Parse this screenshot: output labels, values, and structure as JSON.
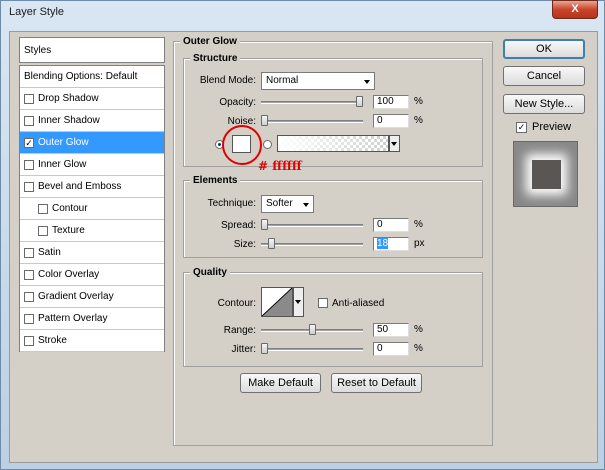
{
  "window": {
    "title": "Layer Style",
    "close_label": "X"
  },
  "sidebar": {
    "header": "Styles",
    "items": [
      {
        "label": "Blending Options: Default",
        "checkbox": false,
        "indent": 0,
        "selected": false
      },
      {
        "label": "Drop Shadow",
        "checkbox": true,
        "checked": false,
        "indent": 0,
        "selected": false
      },
      {
        "label": "Inner Shadow",
        "checkbox": true,
        "checked": false,
        "indent": 0,
        "selected": false
      },
      {
        "label": "Outer Glow",
        "checkbox": true,
        "checked": true,
        "indent": 0,
        "selected": true
      },
      {
        "label": "Inner Glow",
        "checkbox": true,
        "checked": false,
        "indent": 0,
        "selected": false
      },
      {
        "label": "Bevel and Emboss",
        "checkbox": true,
        "checked": false,
        "indent": 0,
        "selected": false
      },
      {
        "label": "Contour",
        "checkbox": true,
        "checked": false,
        "indent": 1,
        "selected": false
      },
      {
        "label": "Texture",
        "checkbox": true,
        "checked": false,
        "indent": 1,
        "selected": false
      },
      {
        "label": "Satin",
        "checkbox": true,
        "checked": false,
        "indent": 0,
        "selected": false
      },
      {
        "label": "Color Overlay",
        "checkbox": true,
        "checked": false,
        "indent": 0,
        "selected": false
      },
      {
        "label": "Gradient Overlay",
        "checkbox": true,
        "checked": false,
        "indent": 0,
        "selected": false
      },
      {
        "label": "Pattern Overlay",
        "checkbox": true,
        "checked": false,
        "indent": 0,
        "selected": false
      },
      {
        "label": "Stroke",
        "checkbox": true,
        "checked": false,
        "indent": 0,
        "selected": false
      }
    ]
  },
  "outer_glow": {
    "title": "Outer Glow",
    "structure": {
      "title": "Structure",
      "blend_mode_label": "Blend Mode:",
      "blend_mode_value": "Normal",
      "opacity_label": "Opacity:",
      "opacity_value": "100",
      "opacity_level": 1.0,
      "noise_label": "Noise:",
      "noise_value": "0",
      "noise_level": 0,
      "unit_percent": "%",
      "annotation": "# ffffff",
      "annotation_color": "#e00000",
      "glow_color": "#ffffff"
    },
    "elements": {
      "title": "Elements",
      "technique_label": "Technique:",
      "technique_value": "Softer",
      "spread_label": "Spread:",
      "spread_value": "0",
      "spread_level": 0,
      "size_label": "Size:",
      "size_value": "18",
      "size_level": 0.07,
      "unit_percent": "%",
      "unit_px": "px"
    },
    "quality": {
      "title": "Quality",
      "contour_label": "Contour:",
      "anti_aliased_label": "Anti-aliased",
      "range_label": "Range:",
      "range_value": "50",
      "range_level": 0.5,
      "jitter_label": "Jitter:",
      "jitter_value": "0",
      "jitter_level": 0,
      "unit_percent": "%"
    },
    "make_default_label": "Make Default",
    "reset_default_label": "Reset to Default"
  },
  "right": {
    "ok_label": "OK",
    "cancel_label": "Cancel",
    "new_style_label": "New Style...",
    "preview_label": "Preview",
    "preview_checked": true
  }
}
